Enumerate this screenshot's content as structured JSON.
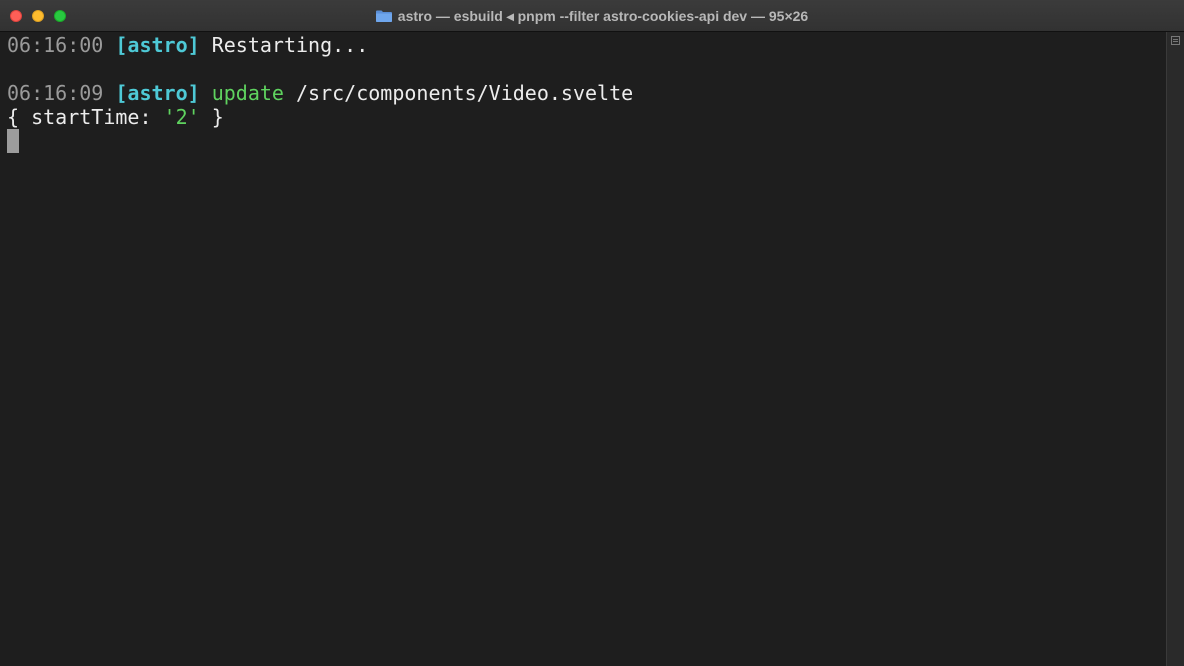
{
  "window": {
    "title": "astro — esbuild ◂ pnpm --filter astro-cookies-api dev — 95×26"
  },
  "terminal": {
    "lines": [
      {
        "timestamp": "06:16:00",
        "tag": "[astro]",
        "message": "Restarting..."
      },
      {
        "timestamp": "06:16:09",
        "tag": "[astro]",
        "action": "update",
        "path": "/src/components/Video.svelte"
      },
      {
        "object_open": "{ startTime: ",
        "value": "'2'",
        "object_close": " }"
      }
    ]
  },
  "colors": {
    "background": "#1e1e1e",
    "timestamp": "#9a9a9a",
    "tag": "#4ec9d6",
    "green": "#5fd35f",
    "text": "#ececec"
  },
  "icons": {
    "folder": "folder-icon",
    "scroll_marker": "marks-icon"
  }
}
